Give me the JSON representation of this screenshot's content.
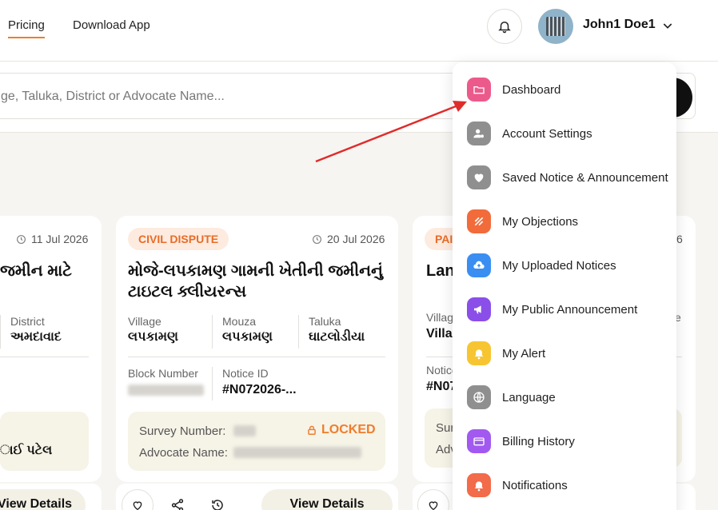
{
  "header": {
    "nav": [
      {
        "label": "Pricing"
      },
      {
        "label": "Download App"
      }
    ],
    "user_name": "John1 Doe1"
  },
  "search": {
    "placeholder": "ge, Taluka, District or Advocate Name..."
  },
  "cards": [
    {
      "date": "11 Jul 2026",
      "title": "જમીન માટે",
      "district_label": "District",
      "district_value": "અમદાવાદ",
      "advocate_value": "ાઈ પટેલ",
      "view_label": "View Details"
    },
    {
      "badge": "CIVIL DISPUTE",
      "date": "20 Jul 2026",
      "title": "મોજે-લપકામણ ગામની ખેતીની જમીનનું ટાઇટલ ક્લીયરન્સ",
      "village_label": "Village",
      "village_value": "લપકામણ",
      "mouza_label": "Mouza",
      "mouza_value": "લપકામણ",
      "taluka_label": "Taluka",
      "taluka_value": "ઘાટલોડીયા",
      "block_label": "Block Number",
      "notice_label": "Notice ID",
      "notice_value": "#N072026-...",
      "survey_label": "Survey Number:",
      "advocate_label": "Advocate Name:",
      "locked_label": "LOCKED",
      "view_label": "View Details"
    },
    {
      "badge": "PAI",
      "date": "6",
      "title": "Land",
      "village_label": "Villag",
      "village_value": "Villa",
      "mouza_label": "e",
      "notice_label": "Notice",
      "notice_value": "#N07",
      "survey_label": "Sur",
      "advocate_label": "Adv"
    }
  ],
  "menu": [
    {
      "label": "Dashboard",
      "icon": "folder-icon",
      "color": "#ec5a8c"
    },
    {
      "label": "Account Settings",
      "icon": "user-gear-icon",
      "color": "#8f8f8f"
    },
    {
      "label": "Saved Notice & Announcement",
      "icon": "heart-icon",
      "color": "#8f8f8f"
    },
    {
      "label": "My Objections",
      "icon": "objection-icon",
      "color": "#f26b3a"
    },
    {
      "label": "My Uploaded Notices",
      "icon": "upload-cloud-icon",
      "color": "#3a8ef2"
    },
    {
      "label": "My Public Announcement",
      "icon": "megaphone-icon",
      "color": "#8a4fe8"
    },
    {
      "label": "My Alert",
      "icon": "bell-icon",
      "color": "#f7c531"
    },
    {
      "label": "Language",
      "icon": "globe-icon",
      "color": "#8f8f8f"
    },
    {
      "label": "Billing History",
      "icon": "card-icon",
      "color": "#a259f0"
    },
    {
      "label": "Notifications",
      "icon": "bell-alert-icon",
      "color": "#f26b4a"
    }
  ]
}
